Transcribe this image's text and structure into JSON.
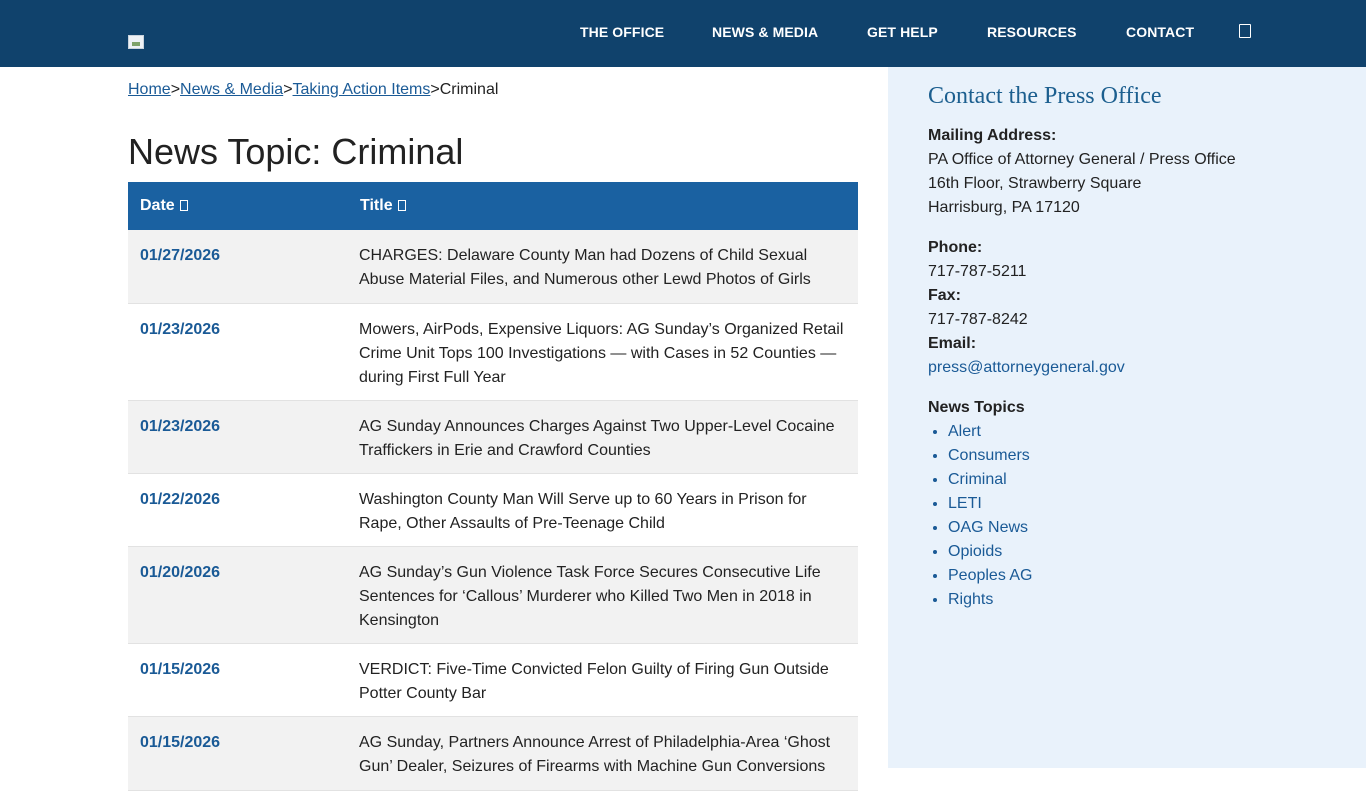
{
  "header": {
    "nav": [
      "THE OFFICE",
      "NEWS & MEDIA",
      "GET HELP",
      "RESOURCES",
      "CONTACT"
    ]
  },
  "breadcrumb": {
    "home": "Home",
    "news_media": "News & Media",
    "taking_action": "Taking Action Items",
    "current": "Criminal",
    "separator": ">"
  },
  "page_title": "News Topic: Criminal",
  "table": {
    "headers": [
      "Date",
      "Title"
    ],
    "rows": [
      {
        "date": "01/27/2026",
        "title": "CHARGES: Delaware County Man had Dozens of Child Sexual Abuse Material Files, and Numerous other Lewd Photos of Girls"
      },
      {
        "date": "01/23/2026",
        "title": "Mowers, AirPods, Expensive Liquors: AG Sunday’s Organized Retail Crime Unit Tops 100 Investigations — with Cases in 52 Counties — during First Full Year"
      },
      {
        "date": "01/23/2026",
        "title": "AG Sunday Announces Charges Against Two Upper-Level Cocaine Traffickers in Erie and Crawford Counties"
      },
      {
        "date": "01/22/2026",
        "title": "Washington County Man Will Serve up to 60 Years in Prison for Rape, Other Assaults of Pre-Teenage Child"
      },
      {
        "date": "01/20/2026",
        "title": "AG Sunday’s Gun Violence Task Force Secures Consecutive Life Sentences for ‘Callous’ Murderer who Killed Two Men in 2018 in Kensington"
      },
      {
        "date": "01/15/2026",
        "title": "VERDICT: Five-Time Convicted Felon Guilty of Firing Gun Outside Potter County Bar"
      },
      {
        "date": "01/15/2026",
        "title": "AG Sunday, Partners Announce Arrest of Philadelphia-Area ‘Ghost Gun’ Dealer, Seizures of Firearms with Machine Gun Conversions"
      }
    ]
  },
  "sidebar": {
    "title": "Contact the Press Office",
    "mailing_label": "Mailing Address:",
    "mailing_lines": [
      "PA Office of Attorney General / Press Office",
      "16th Floor, Strawberry Square",
      "Harrisburg, PA 17120"
    ],
    "phone_label": "Phone:",
    "phone": "717-787-5211",
    "fax_label": "Fax:",
    "fax": "717-787-8242",
    "email_label": "Email:",
    "email": "press@attorneygeneral.gov",
    "topics_label": "News Topics",
    "topics": [
      "Alert",
      "Consumers",
      "Criminal",
      "LETI",
      "OAG News",
      "Opioids",
      "Peoples AG",
      "Rights"
    ]
  }
}
